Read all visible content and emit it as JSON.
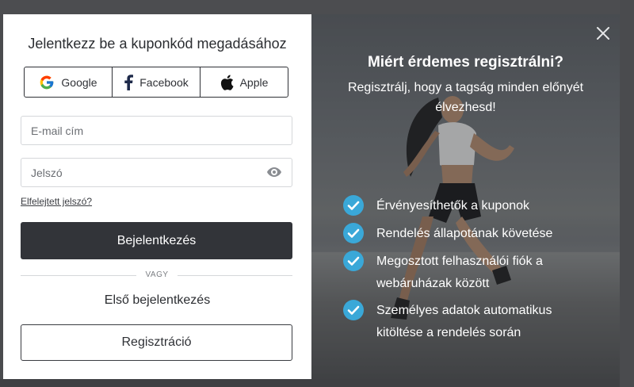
{
  "login": {
    "title": "Jelentkezz be a kuponkód megadásához",
    "social": {
      "google": "Google",
      "facebook": "Facebook",
      "apple": "Apple"
    },
    "email_placeholder": "E-mail cím",
    "password_placeholder": "Jelszó",
    "forgot_password": "Elfelejtett jelszó?",
    "login_button": "Bejelentkezés",
    "divider": "VAGY",
    "first_login": "Első bejelentkezés",
    "register_button": "Regisztráció"
  },
  "promo": {
    "title": "Miért érdemes regisztrálni?",
    "subtitle": "Regisztrálj, hogy a tagság minden előnyét élvezhesd!",
    "benefits": [
      "Érvényesíthetők a kuponok",
      "Rendelés állapotának követése",
      "Megosztott felhasználói fiók a webáruházak között",
      "Személyes adatok automatikus kitöltése a rendelés során"
    ]
  },
  "colors": {
    "accent": "#323439",
    "check": "#3aa8d8",
    "background": "#4a4b4e"
  },
  "icons": {
    "google": "google-icon",
    "facebook": "facebook-icon",
    "apple": "apple-icon",
    "eye": "eye-icon",
    "close": "close-icon",
    "check": "check-circle-icon"
  }
}
